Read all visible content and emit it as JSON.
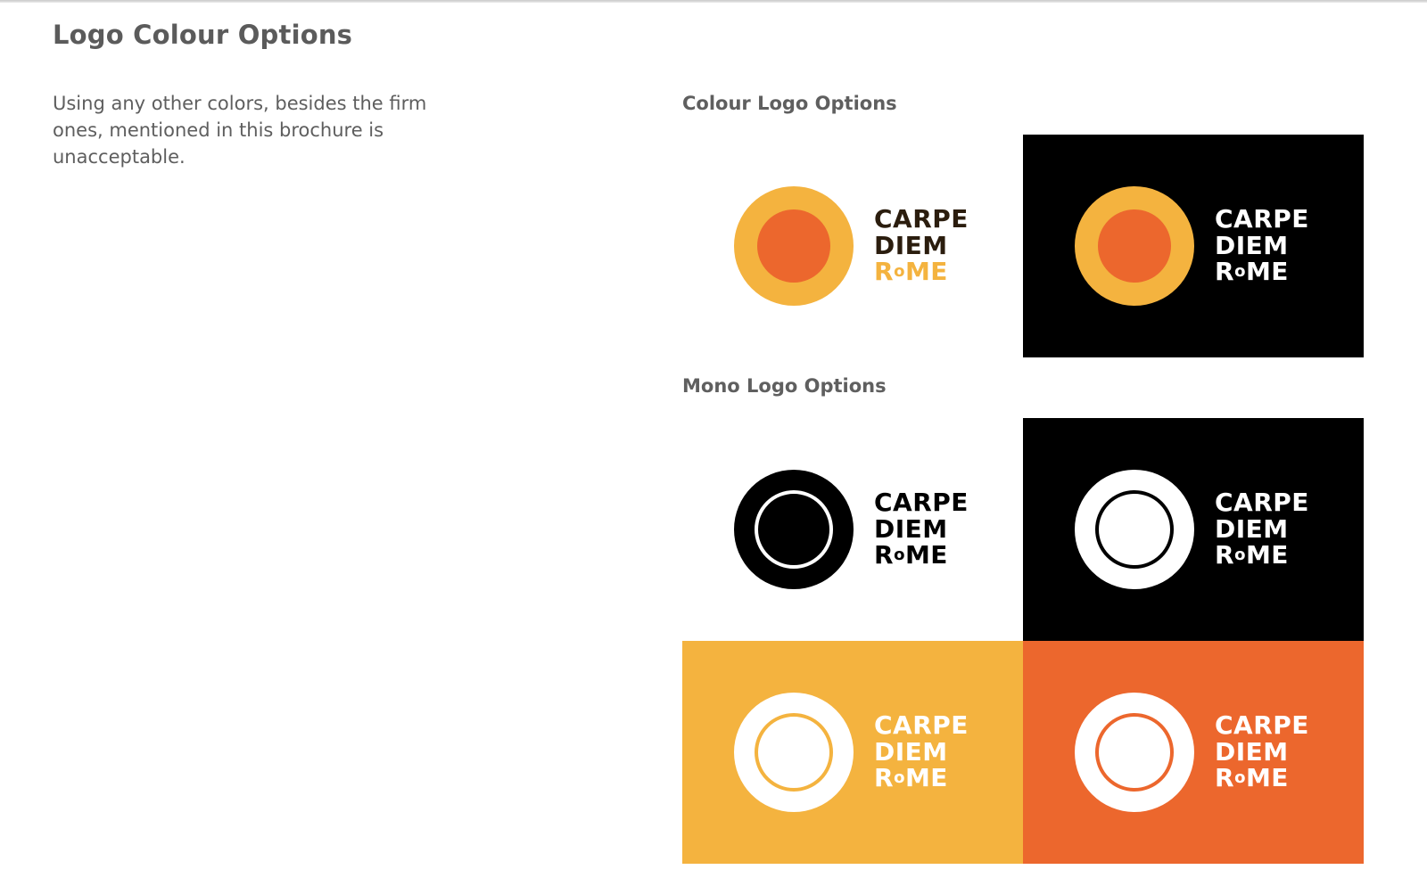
{
  "page": {
    "title": "Logo Colour Options",
    "intro": "Using any other colors, besides the firm ones, mentioned in this brochure is unacceptable."
  },
  "sections": {
    "colour": {
      "label": "Colour Logo Options"
    },
    "mono": {
      "label": "Mono Logo Options"
    }
  },
  "logo_text": {
    "line1": "CARPE",
    "line2": "DIEM",
    "line3_r": "R",
    "line3_o": "o",
    "line3_me": "ME"
  },
  "colors": {
    "yellow": "#f4b33f",
    "orange": "#ec672d",
    "black": "#000000",
    "white": "#ffffff",
    "dark_brown": "#2b1d0e"
  },
  "variants": [
    {
      "name": "colour-on-white",
      "background": "white",
      "mark": "sun-outer-yellow-inner-orange",
      "text": "dark-brown / yellow"
    },
    {
      "name": "colour-on-black",
      "background": "black",
      "mark": "sun-outer-yellow-inner-orange",
      "text": "white"
    },
    {
      "name": "mono-black-on-white",
      "background": "white",
      "mark": "black-ring",
      "text": "black"
    },
    {
      "name": "mono-white-on-black",
      "background": "black",
      "mark": "white-ring",
      "text": "white"
    },
    {
      "name": "mono-white-on-yellow",
      "background": "yellow",
      "mark": "white-ring",
      "text": "white"
    },
    {
      "name": "mono-white-on-orange",
      "background": "orange",
      "mark": "white-ring",
      "text": "white"
    }
  ]
}
